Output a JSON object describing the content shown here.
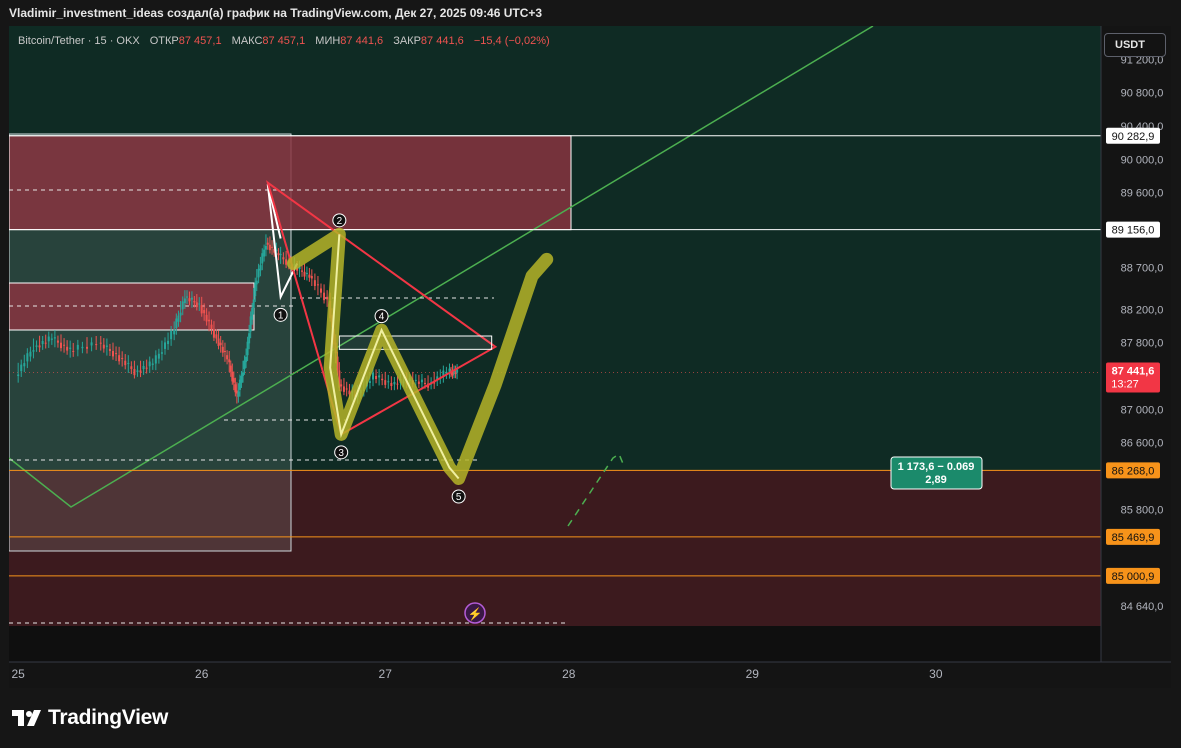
{
  "header": {
    "title": "Vladimir_investment_ideas создал(а) график на TradingView.com, Дек 27, 2025 09:46 UTC+3"
  },
  "legend": {
    "symbol": "Bitcoin/Tether · 15 · OKX",
    "open_label": "ОТКР",
    "open_value": "87 457,1",
    "high_label": "МАКС",
    "high_value": "87 457,1",
    "low_label": "МИН",
    "low_value": "87 441,6",
    "close_label": "ЗАКР",
    "close_value": "87 441,6",
    "change": "−15,4 (−0,02%)"
  },
  "currency_button": "USDT",
  "brand": "TradingView",
  "colors": {
    "background": "#0f0f0f",
    "zone_green": "#0f2b24",
    "zone_red": "#3c1a1e",
    "resistance_box": "#6e2c34",
    "trendline": "#4caf50",
    "triangle": "#f23645",
    "marker": "#b5b428",
    "level_orange": "#f7931a",
    "measure_label": "#1b8a6b",
    "price_label": "#f23645"
  },
  "chart_data": {
    "type": "candlestick",
    "symbol": "Bitcoin/Tether",
    "interval": "15",
    "exchange": "OKX",
    "x_tick_labels": [
      "25",
      "26",
      "27",
      "28",
      "29",
      "30"
    ],
    "y_tick_labels": [
      {
        "value": 91200,
        "label": "91 200,0"
      },
      {
        "value": 90800,
        "label": "90 800,0"
      },
      {
        "value": 90400,
        "label": "90 400,0"
      },
      {
        "value": 90000,
        "label": "90 000,0"
      },
      {
        "value": 89600,
        "label": "89 600,0"
      },
      {
        "value": 88700,
        "label": "88 700,0"
      },
      {
        "value": 88200,
        "label": "88 200,0"
      },
      {
        "value": 87800,
        "label": "87 800,0"
      },
      {
        "value": 87000,
        "label": "87 000,0"
      },
      {
        "value": 86600,
        "label": "86 600,0"
      },
      {
        "value": 85800,
        "label": "85 800,0"
      },
      {
        "value": 84640,
        "label": "84 640,0"
      }
    ],
    "ylim": [
      84400,
      91600
    ],
    "xlim": [
      24.95,
      30.9
    ],
    "horizontal_levels": [
      {
        "value": 90282.9,
        "label": "90 282,9",
        "style": "white"
      },
      {
        "value": 89156.0,
        "label": "89 156,0",
        "style": "white"
      },
      {
        "value": 86268.0,
        "label": "86 268,0",
        "style": "orange"
      },
      {
        "value": 85469.9,
        "label": "85 469,9",
        "style": "orange"
      },
      {
        "value": 85000.9,
        "label": "85 000,9",
        "style": "orange"
      }
    ],
    "current_price": {
      "value": 87441.6,
      "label": "87 441,6",
      "countdown": "13:27"
    },
    "price_path": [
      [
        25.0,
        87400
      ],
      [
        25.1,
        87750
      ],
      [
        25.2,
        87850
      ],
      [
        25.3,
        87700
      ],
      [
        25.45,
        87800
      ],
      [
        25.55,
        87650
      ],
      [
        25.65,
        87450
      ],
      [
        25.75,
        87550
      ],
      [
        25.85,
        87900
      ],
      [
        25.92,
        88350
      ],
      [
        26.0,
        88250
      ],
      [
        26.08,
        87900
      ],
      [
        26.15,
        87600
      ],
      [
        26.2,
        87150
      ],
      [
        26.25,
        87650
      ],
      [
        26.3,
        88500
      ],
      [
        26.36,
        89000
      ],
      [
        26.43,
        88850
      ],
      [
        26.52,
        88700
      ],
      [
        26.6,
        88600
      ],
      [
        26.7,
        88300
      ],
      [
        26.76,
        87300
      ],
      [
        26.85,
        87150
      ],
      [
        26.95,
        87400
      ],
      [
        27.05,
        87300
      ],
      [
        27.15,
        87350
      ],
      [
        27.25,
        87300
      ],
      [
        27.35,
        87450
      ],
      [
        27.4,
        87441.6
      ]
    ],
    "pattern_points": [
      {
        "label": "1",
        "x": 26.43,
        "y": 88350
      },
      {
        "label": "2",
        "x": 26.75,
        "y": 89100
      },
      {
        "label": "3",
        "x": 26.76,
        "y": 86700
      },
      {
        "label": "4",
        "x": 26.98,
        "y": 87950
      },
      {
        "label": "5",
        "x": 27.4,
        "y": 86170
      }
    ],
    "measurement_label": {
      "line1": "1 173,6 − 0.069",
      "line2": "2,89"
    }
  }
}
